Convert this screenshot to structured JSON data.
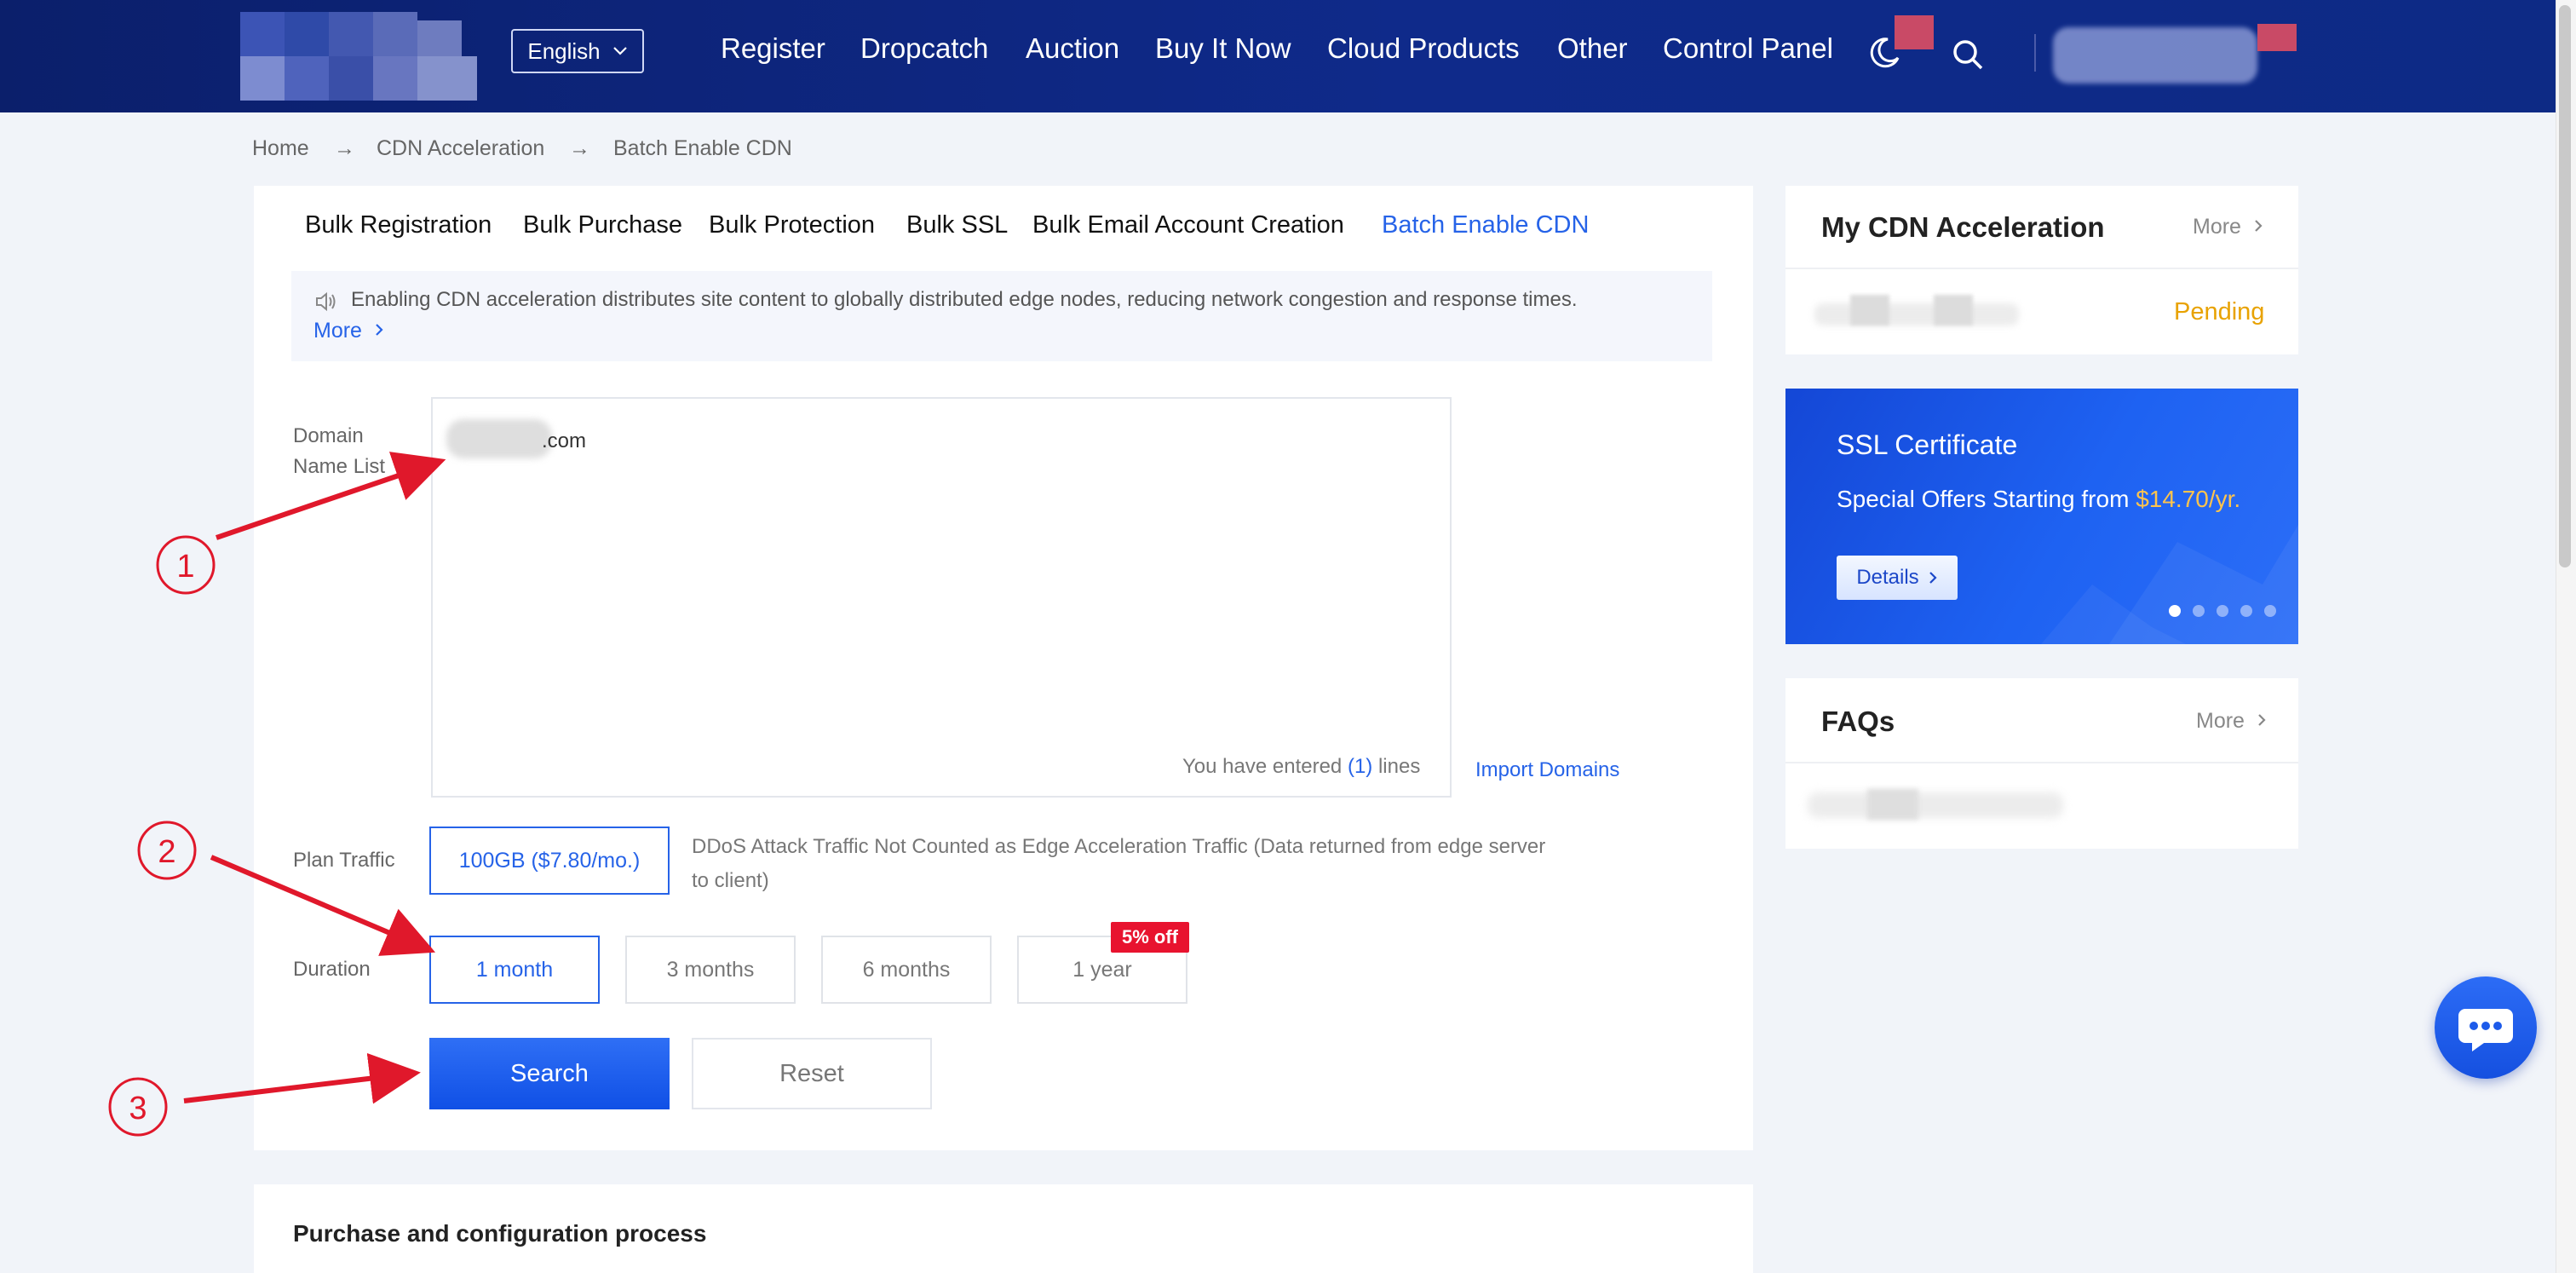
{
  "header": {
    "language": "English",
    "nav": [
      "Register",
      "Dropcatch",
      "Auction",
      "Buy It Now",
      "Cloud Products",
      "Other",
      "Control Panel"
    ],
    "icons": [
      "theme-icon",
      "search-icon",
      "chevron-down-icon"
    ]
  },
  "breadcrumb": {
    "home": "Home",
    "section": "CDN Acceleration",
    "current": "Batch Enable CDN",
    "separator": "→"
  },
  "tabs": [
    "Bulk Registration",
    "Bulk Purchase",
    "Bulk Protection",
    "Bulk SSL",
    "Bulk Email Account Creation",
    "Batch Enable CDN"
  ],
  "active_tab": "Batch Enable CDN",
  "notice": {
    "text": "Enabling CDN acceleration distributes site content to globally distributed edge nodes, reducing network congestion and response times.",
    "more": "More"
  },
  "form": {
    "domain_label": "Domain Name List",
    "domain_value": ".com",
    "line_count_prefix": "You have entered",
    "line_count_value": "(1)",
    "line_count_suffix": "lines",
    "import_domains": "Import Domains",
    "plan_label": "Plan Traffic",
    "plan_option": "100GB ($7.80/mo.)",
    "plan_note": "DDoS Attack Traffic Not Counted as Edge Acceleration Traffic (Data returned from edge server to client)",
    "duration_label": "Duration",
    "durations": [
      "1 month",
      "3 months",
      "6 months",
      "1 year"
    ],
    "selected_duration": "1 month",
    "discount_badge": "5% off",
    "search_button": "Search",
    "reset_button": "Reset"
  },
  "process": {
    "title": "Purchase and configuration process"
  },
  "sidebar": {
    "cdn": {
      "title": "My CDN Acceleration",
      "more": "More",
      "status": "Pending"
    },
    "ssl": {
      "title": "SSL Certificate",
      "offer_prefix": "Special Offers Starting from ",
      "price": "$14.70/yr.",
      "details": "Details",
      "slides": 5,
      "active_slide": 1
    },
    "faq": {
      "title": "FAQs",
      "more": "More"
    }
  },
  "annotations": [
    "1",
    "2",
    "3"
  ],
  "colors": {
    "header_bg": "#0f2a8a",
    "accent": "#2663e8",
    "pending": "#e8a200",
    "price": "#ffc44d",
    "badge": "#e8132f",
    "annotation": "#e0182b"
  }
}
